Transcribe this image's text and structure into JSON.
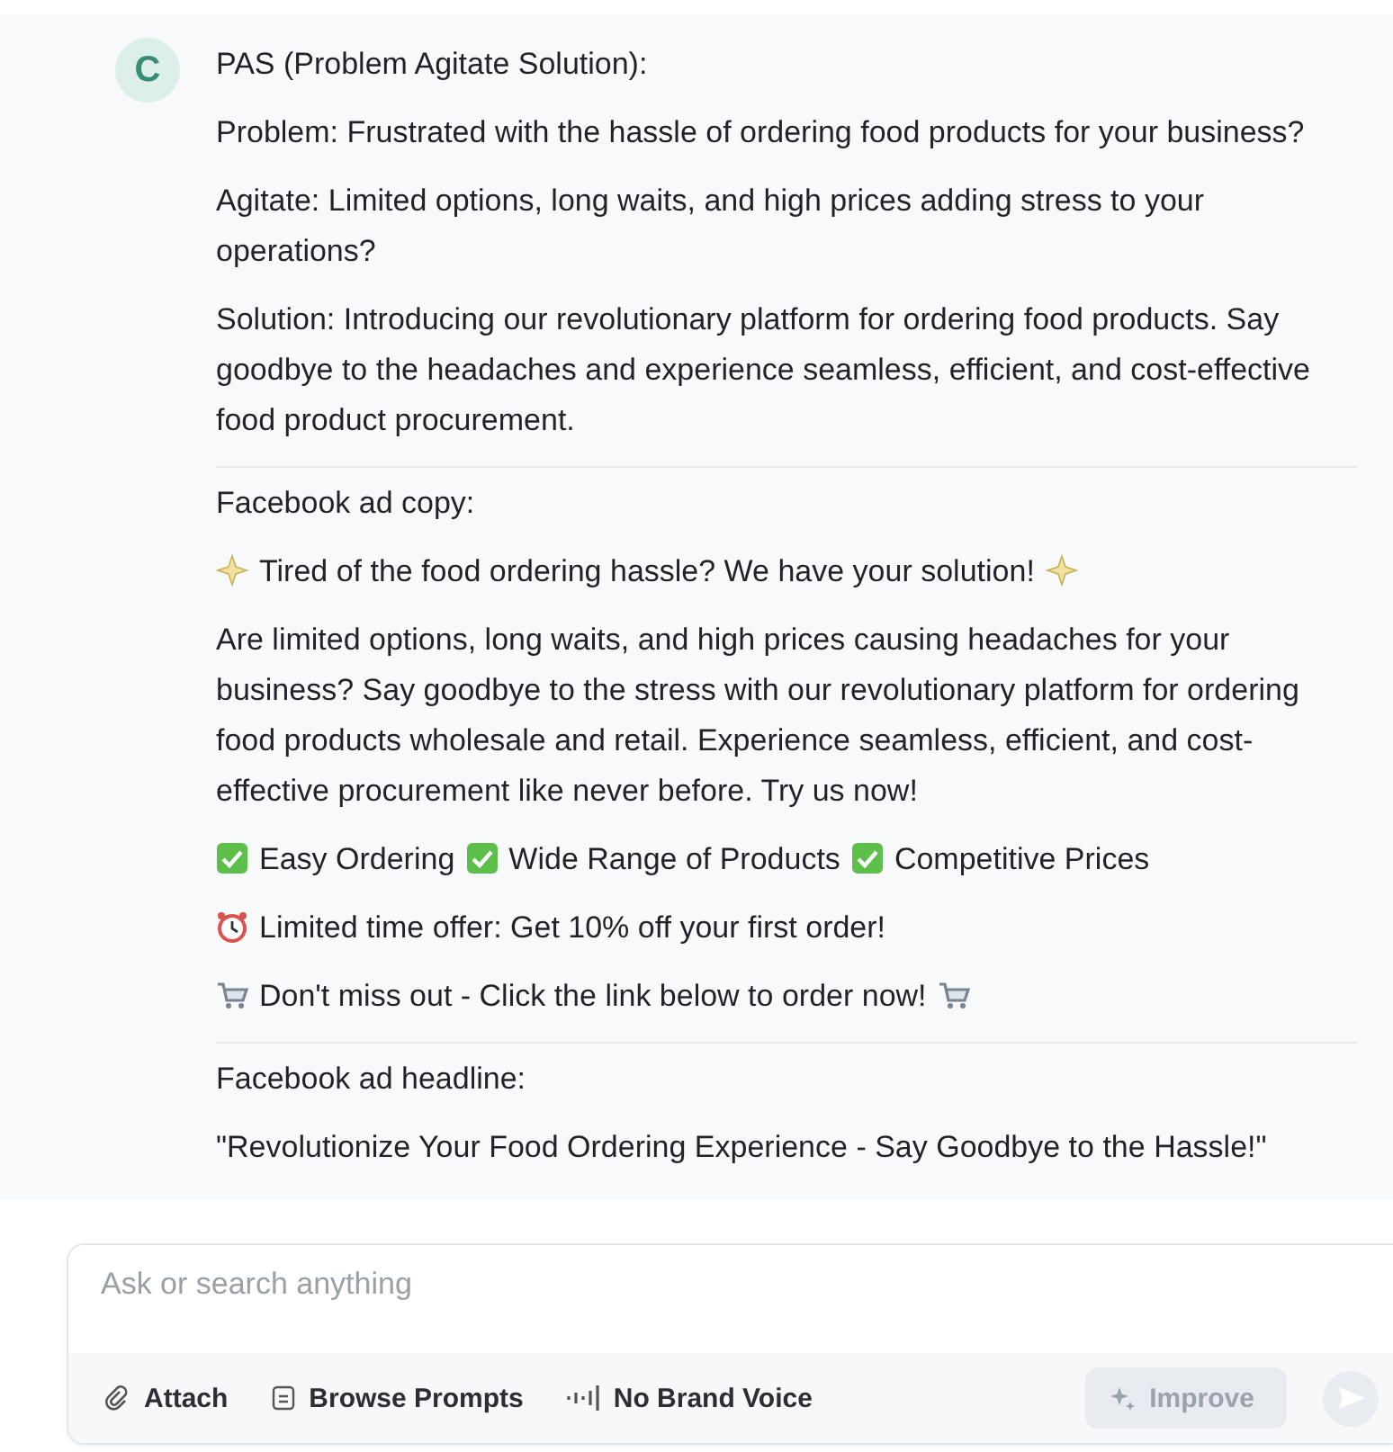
{
  "message": {
    "avatar": "C",
    "sections": [
      {
        "title": "PAS (Problem Agitate Solution):",
        "paragraphs": [
          {
            "segments": [
              {
                "kind": "text",
                "text": "Problem: Frustrated with the hassle of ordering food products for your business?"
              }
            ]
          },
          {
            "segments": [
              {
                "kind": "text",
                "text": "Agitate: Limited options, long waits, and high prices adding stress to your operations?"
              }
            ]
          },
          {
            "segments": [
              {
                "kind": "text",
                "text": "Solution: Introducing our revolutionary platform for ordering food products. Say goodbye to the headaches and experience seamless, efficient, and cost-effective food product procurement."
              }
            ]
          }
        ]
      },
      {
        "title": "Facebook ad copy:",
        "paragraphs": [
          {
            "segments": [
              {
                "kind": "sparkle"
              },
              {
                "kind": "text",
                "text": "Tired of the food ordering hassle? We have your solution!"
              },
              {
                "kind": "sparkle"
              }
            ]
          },
          {
            "segments": [
              {
                "kind": "text",
                "text": "Are limited options, long waits, and high prices causing headaches for your business? Say goodbye to the stress with our revolutionary platform for ordering food products wholesale and retail. Experience seamless, efficient, and cost-effective procurement like never before. Try us now!"
              }
            ]
          },
          {
            "segments": [
              {
                "kind": "check"
              },
              {
                "kind": "text",
                "text": "Easy Ordering"
              },
              {
                "kind": "check"
              },
              {
                "kind": "text",
                "text": "Wide Range of Products"
              },
              {
                "kind": "check"
              },
              {
                "kind": "text",
                "text": "Competitive Prices"
              }
            ]
          },
          {
            "segments": [
              {
                "kind": "clock"
              },
              {
                "kind": "text",
                "text": "Limited time offer: Get 10% off your first order!"
              }
            ]
          },
          {
            "segments": [
              {
                "kind": "cart"
              },
              {
                "kind": "text",
                "text": "Don't miss out - Click the link below to order now!"
              },
              {
                "kind": "cart"
              }
            ]
          }
        ]
      },
      {
        "title": "Facebook ad headline:",
        "paragraphs": [
          {
            "segments": [
              {
                "kind": "text",
                "text": "\"Revolutionize Your Food Ordering Experience - Say Goodbye to the Hassle!\""
              }
            ]
          }
        ]
      }
    ]
  },
  "composer": {
    "placeholder": "Ask or search anything",
    "tools": [
      {
        "kind": "attach",
        "label": "Attach"
      },
      {
        "kind": "prompts",
        "label": "Browse Prompts"
      },
      {
        "kind": "voice",
        "label": "No Brand Voice"
      }
    ],
    "improve": {
      "label": "Improve",
      "disabled": true
    },
    "send": {
      "disabled": true
    }
  }
}
